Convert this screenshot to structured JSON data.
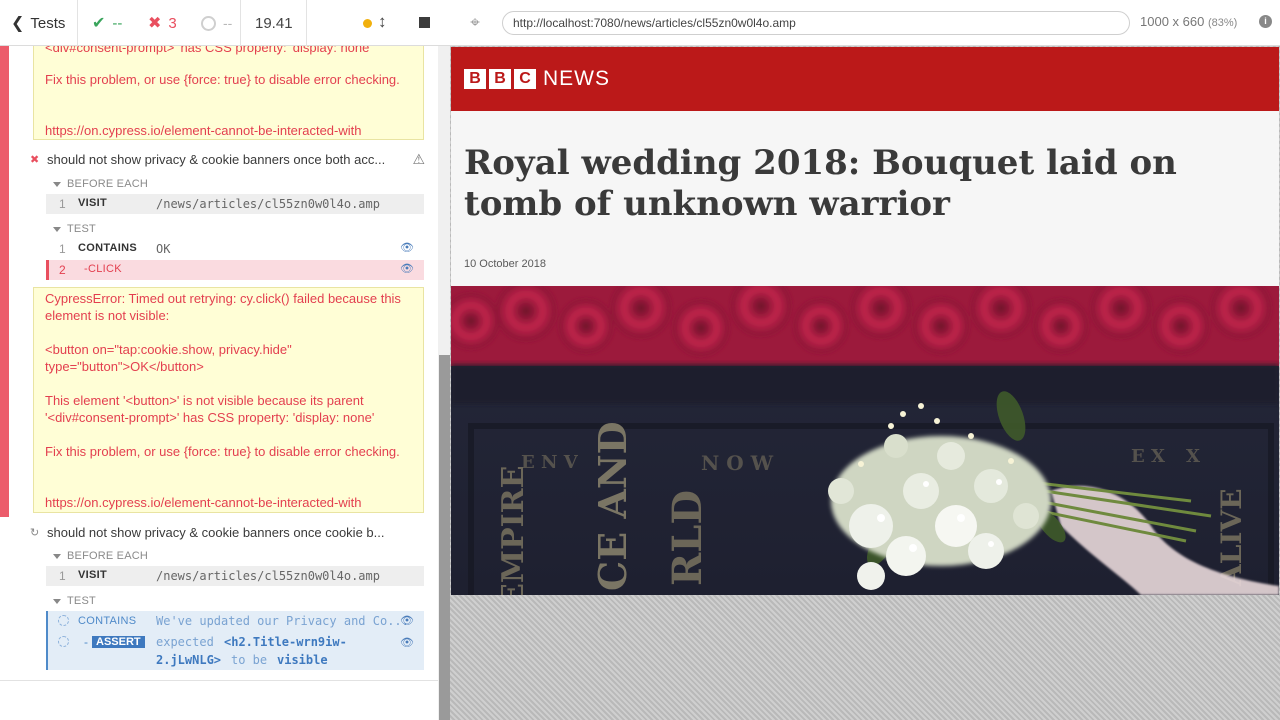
{
  "stats": {
    "back_label": "Tests",
    "passed": "--",
    "failed": "3",
    "pending": "--",
    "duration": "19.41"
  },
  "reporter": {
    "prev_error": {
      "cut_line": "<div#consent-prompt>' has CSS property: 'display: none'",
      "fix": "Fix this problem, or use {force: true} to disable error checking.",
      "link": "https://on.cypress.io/element-cannot-be-interacted-with"
    },
    "test1": {
      "title": "should not show privacy & cookie banners once both acc...",
      "hook_before": "BEFORE EACH",
      "visit": {
        "num": "1",
        "name": "VISIT",
        "msg": "/news/articles/cl55zn0w0l4o.amp"
      },
      "hook_test": "TEST",
      "contains": {
        "num": "1",
        "name": "CONTAINS",
        "msg": "OK"
      },
      "click": {
        "num": "2",
        "name": "-CLICK"
      },
      "error": {
        "line1": "CypressError: Timed out retrying: cy.click() failed because this element is not visible:",
        "line2": "<button on=\"tap:cookie.show, privacy.hide\" type=\"button\">OK</button>",
        "line3": "This element '<button>' is not visible because its parent '<div#consent-prompt>' has CSS property: 'display: none'",
        "line4": "Fix this problem, or use {force: true} to disable error checking.",
        "line5": "https://on.cypress.io/element-cannot-be-interacted-with"
      }
    },
    "test2": {
      "title": "should not show privacy & cookie banners once cookie b...",
      "hook_before": "BEFORE EACH",
      "visit": {
        "num": "1",
        "name": "VISIT",
        "msg": "/news/articles/cl55zn0w0l4o.amp"
      },
      "hook_test": "TEST",
      "contains": {
        "name": "CONTAINS",
        "msg": "We've updated our Privacy and Co..."
      },
      "assert": {
        "dash": "-",
        "name": "ASSERT",
        "expected": "expected",
        "selector1": "<h2.Title-wrn9iw-",
        "selector2": "2.jLwNLG>",
        "to_be": "to be",
        "visible": "visible"
      }
    }
  },
  "aut": {
    "url": "http://localhost:7080/news/articles/cl55zn0w0l4o.amp",
    "viewport": "1000 x 660",
    "scale": "(83%)"
  },
  "article": {
    "brand_b1": "B",
    "brand_b2": "B",
    "brand_c": "C",
    "brand_news": "NEWS",
    "headline": "Royal wedding 2018: Bouquet laid on tomb of unknown warrior",
    "date": "10 October 2018",
    "tomb_text_1": "EMPIRE",
    "tomb_text_2": "CE AND",
    "tomb_text_3": "RLD",
    "tomb_text_4": "ALIVE",
    "tomb_text_5": "E N V",
    "tomb_text_6": "N O W",
    "tomb_text_7": "E X",
    "tomb_text_8": "X"
  },
  "colors": {
    "bbc_red": "#bb1919",
    "fail_red": "#e94f5f",
    "pass_green": "#3aa55c",
    "pending_blue": "#4f8ac9",
    "error_bg": "#fffed6"
  }
}
